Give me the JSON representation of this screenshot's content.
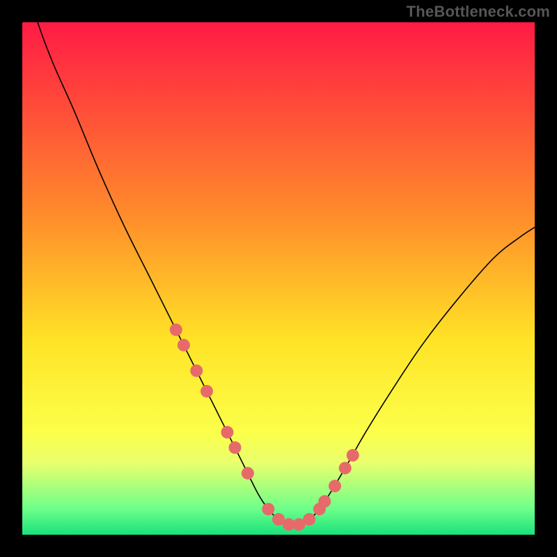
{
  "watermark": "TheBottleneck.com",
  "colors": {
    "curve": "#000000",
    "marker": "#e76a6a",
    "gradient_top": "#ff1b45",
    "gradient_bottom": "#18e27a",
    "frame": "#000000"
  },
  "chart_data": {
    "type": "line",
    "title": "",
    "xlabel": "",
    "ylabel": "",
    "xlim": [
      0,
      100
    ],
    "ylim": [
      0,
      100
    ],
    "grid": false,
    "legend": null,
    "x": [
      0,
      3,
      6,
      10,
      15,
      20,
      25,
      30,
      34,
      37,
      40,
      43,
      46,
      48,
      50,
      52,
      54,
      56,
      58,
      60,
      63,
      67,
      72,
      78,
      85,
      92,
      97,
      100
    ],
    "values": [
      110,
      100,
      92,
      83,
      71,
      60,
      50,
      40,
      32,
      26,
      20,
      14,
      8,
      5,
      3,
      2,
      2,
      3,
      5,
      8,
      13,
      20,
      28,
      37,
      46,
      54,
      58,
      60
    ],
    "markers_x": [
      30,
      31.5,
      34,
      36,
      40,
      41.5,
      44,
      48,
      50,
      52,
      54,
      56,
      58,
      59,
      61,
      63,
      64.5
    ],
    "markers_y": [
      40,
      37,
      32,
      28,
      20,
      17,
      12,
      5,
      3,
      2,
      2,
      3,
      5,
      6.5,
      9.5,
      13,
      15.5
    ],
    "marker_radius_px": 9
  }
}
